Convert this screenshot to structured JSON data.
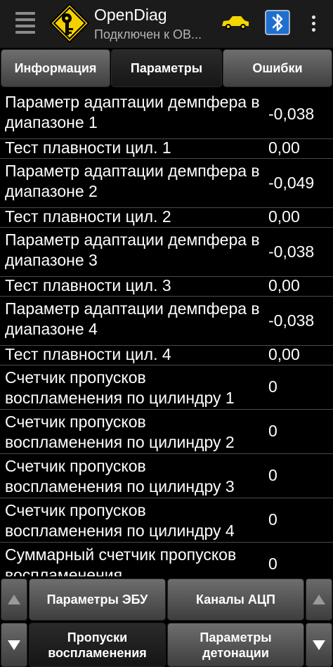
{
  "app": {
    "title": "OpenDiag",
    "subtitle": "Подключен к ОВ...",
    "icons": [
      "menu-icon",
      "app-logo-key-icon",
      "car-icon",
      "bluetooth-icon",
      "overflow-menu-icon"
    ],
    "colors": {
      "logo_yellow": "#f5d000",
      "car_yellow": "#f2d600",
      "bluetooth_blue": "#1f6fd0"
    }
  },
  "tabs": [
    {
      "label": "Информация",
      "active": false
    },
    {
      "label": "Параметры",
      "active": true
    },
    {
      "label": "Ошибки",
      "active": false
    }
  ],
  "parameters": [
    {
      "name": "Параметр адаптации демпфера в диапазоне 1",
      "value": "-0,038"
    },
    {
      "name": "Тест плавности цил. 1",
      "value": "0,00"
    },
    {
      "name": "Параметр адаптации демпфера в диапазоне 2",
      "value": "-0,049"
    },
    {
      "name": "Тест плавности цил. 2",
      "value": "0,00"
    },
    {
      "name": "Параметр адаптации демпфера в диапазоне 3",
      "value": "-0,038"
    },
    {
      "name": "Тест плавности цил. 3",
      "value": "0,00"
    },
    {
      "name": "Параметр адаптации демпфера в диапазоне 4",
      "value": "-0,038"
    },
    {
      "name": "Тест плавности цил. 4",
      "value": "0,00"
    },
    {
      "name": "Счетчик пропусков воспламенения по цилиндру 1",
      "value": "0"
    },
    {
      "name": "Счетчик пропусков воспламенения по цилиндру 2",
      "value": "0"
    },
    {
      "name": "Счетчик пропусков воспламенения по цилиндру 3",
      "value": "0"
    },
    {
      "name": "Счетчик пропусков воспламенения по цилиндру 4",
      "value": "0"
    },
    {
      "name": "Суммарный счетчик пропусков воспламенения",
      "value": "0"
    }
  ],
  "bottom_nav": {
    "buttons": [
      {
        "label": "Параметры ЭБУ",
        "active": false
      },
      {
        "label": "Каналы АЦП",
        "active": false
      },
      {
        "label": "Пропуски воспламенения",
        "active": true
      },
      {
        "label": "Параметры детонации",
        "active": false
      }
    ],
    "icons": [
      "scroll-up-arrow-icon",
      "scroll-down-arrow-icon"
    ]
  }
}
